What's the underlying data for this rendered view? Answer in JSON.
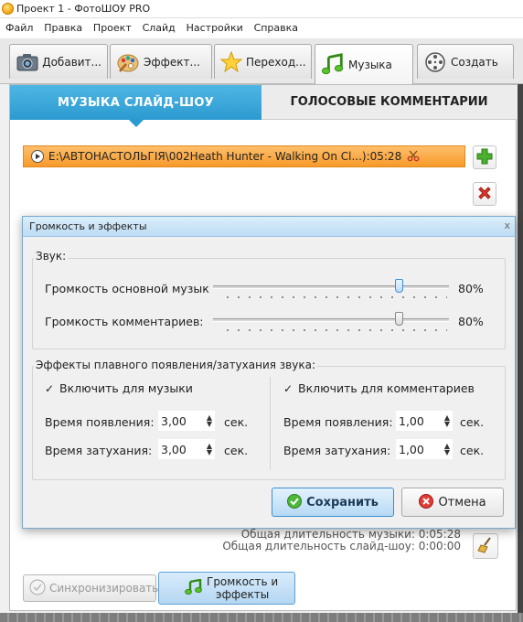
{
  "window": {
    "title": "Проект 1 - ФотоШОУ PRO"
  },
  "menu": [
    "Файл",
    "Правка",
    "Проект",
    "Слайд",
    "Настройки",
    "Справка"
  ],
  "tabs": [
    {
      "label": "Добавит...",
      "icon": "camera-icon"
    },
    {
      "label": "Эффект...",
      "icon": "palette-icon"
    },
    {
      "label": "Переход...",
      "icon": "star-icon"
    },
    {
      "label": "Музыка",
      "icon": "music-note-icon",
      "active": true
    },
    {
      "label": "Создать",
      "icon": "film-reel-icon"
    }
  ],
  "subtabs": {
    "music": "МУЗЫКА СЛАЙД-ШОУ",
    "voice": "ГОЛОСОВЫЕ КОММЕНТАРИИ"
  },
  "track": {
    "text": "E:\\АВТОНАСТОЛЬГIЯ\\002Heath Hunter - Walking On Cl...):05:28"
  },
  "durations": {
    "music_partial": "Общая длительность музыки: 0:05:28",
    "slideshow": "Общая длительность слайд-шоу: 0:00:00"
  },
  "bottom_buttons": {
    "sync": "Синхронизировать",
    "volume_line1": "Громкость и",
    "volume_line2": "эффекты"
  },
  "dialog": {
    "title": "Громкость и эффекты",
    "close": "x",
    "sound_group": "Звук:",
    "main_volume_label": "Громкость основной музык",
    "main_volume_pct": "80%",
    "main_volume_level": 0.8,
    "comment_volume_label": "Громкость комментариев:",
    "comment_volume_pct": "80%",
    "comment_volume_level": 0.8,
    "fade_group": "Эффекты плавного появления/затухания звука:",
    "music": {
      "enable_label": "Включить для музыки",
      "checked": true,
      "fade_in_label": "Время появления:",
      "fade_in_value": "3,00",
      "fade_out_label": "Время затухания:",
      "fade_out_value": "3,00",
      "unit": "сек."
    },
    "comments": {
      "enable_label": "Включить для комментариев",
      "checked": true,
      "fade_in_label": "Время появления:",
      "fade_in_value": "1,00",
      "fade_out_label": "Время затухания:",
      "fade_out_value": "1,00",
      "unit": "сек."
    },
    "save_label": "Сохранить",
    "cancel_label": "Отмена",
    "checkmark": "✓"
  }
}
